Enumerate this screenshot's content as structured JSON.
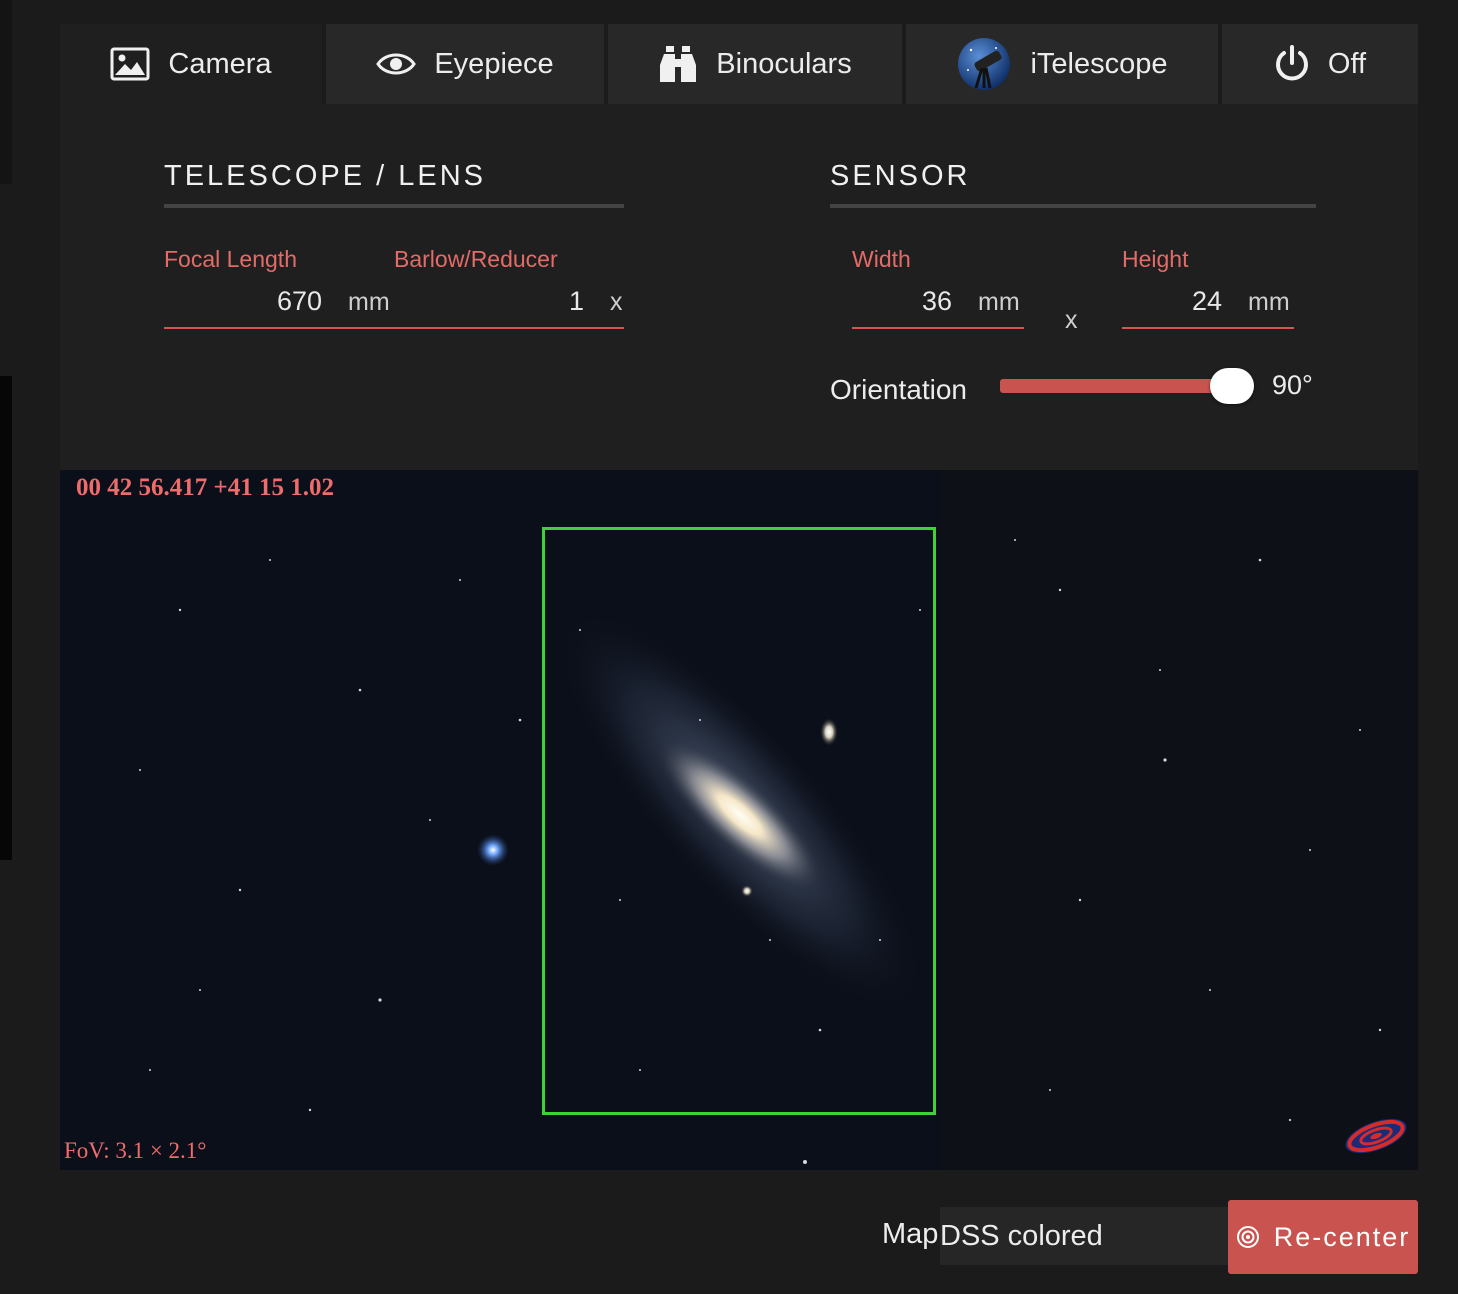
{
  "tabs": [
    {
      "label": "Camera",
      "icon": "image-icon",
      "active": true
    },
    {
      "label": "Eyepiece",
      "icon": "eye-icon",
      "active": false
    },
    {
      "label": "Binoculars",
      "icon": "binoculars-icon",
      "active": false
    },
    {
      "label": "iTelescope",
      "icon": "telescope-logo-icon",
      "active": false
    },
    {
      "label": "Off",
      "icon": "power-icon",
      "active": false
    }
  ],
  "telescope": {
    "title": "TELESCOPE / LENS",
    "focal_length_label": "Focal Length",
    "focal_length_value": "670",
    "focal_length_unit": "mm",
    "barlow_label": "Barlow/Reducer",
    "barlow_value": "1",
    "barlow_unit": "x"
  },
  "sensor": {
    "title": "SENSOR",
    "width_label": "Width",
    "width_value": "36",
    "width_unit": "mm",
    "separator": "x",
    "height_label": "Height",
    "height_value": "24",
    "height_unit": "mm",
    "orientation_label": "Orientation",
    "orientation_value": "90°",
    "orientation_fraction": 1.0
  },
  "sky": {
    "coordinates": "00 42 56.417 +41 15 1.02",
    "fov": "FoV: 3.1 × 2.1°"
  },
  "footer": {
    "map_label": "Map",
    "map_value": "DSS colored",
    "recenter_label": "Re-center"
  },
  "colors": {
    "accent": "#c9534f",
    "label": "#e36b68",
    "frame": "#3fd13a"
  }
}
